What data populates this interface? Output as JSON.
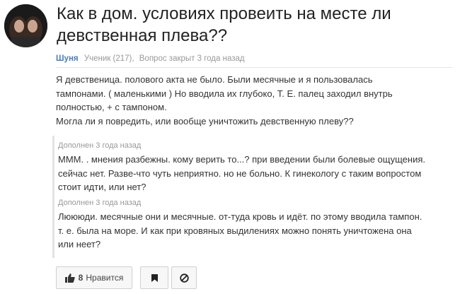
{
  "question": {
    "title_line1": "Как в дом. условиях провеить на месте ли",
    "title_line2": "девственная плева??",
    "author": "Шуня",
    "level": "Ученик (217),",
    "status": "Вопрос закрыт 3 года назад",
    "text_lines": [
      "Я девственица. полового акта не было. Были месячные и я пользовалась",
      "тампонами. ( маленькими ) Но вводила их глубоко, Т. Е. палец заходил внутрь",
      "полностью, + с тампоном.",
      "Могла ли я повредить, или вообще уничтожить девственную плеву??"
    ]
  },
  "additions": [
    {
      "label": "Дополнен 3 года назад",
      "text_lines": [
        "МММ. . мнения разбежны. кому верить то...? при введении были болевые ощущения.",
        "сейчас нет. Разве-что чуть неприятно. но не больно. К гинекологу с таким вопростом",
        "стоит идти, или нет?"
      ]
    },
    {
      "label": "Дополнен 3 года назад",
      "text_lines": [
        "Люююди. месячные они и месячные. от-туда кровь и идёт. по этому вводила тампон.",
        "т. е. была на море. И как при кровяных выдилениях можно понять уничтожена она",
        "или неет?"
      ]
    }
  ],
  "actions": {
    "like_count": "8",
    "like_label": "Нравится",
    "like_icon": "thumbs-up-icon",
    "flag_icon": "bookmark-icon",
    "block_icon": "block-icon"
  },
  "colors": {
    "author": "#4a7cbf",
    "meta": "#999999",
    "text": "#333333",
    "title": "#222222"
  }
}
